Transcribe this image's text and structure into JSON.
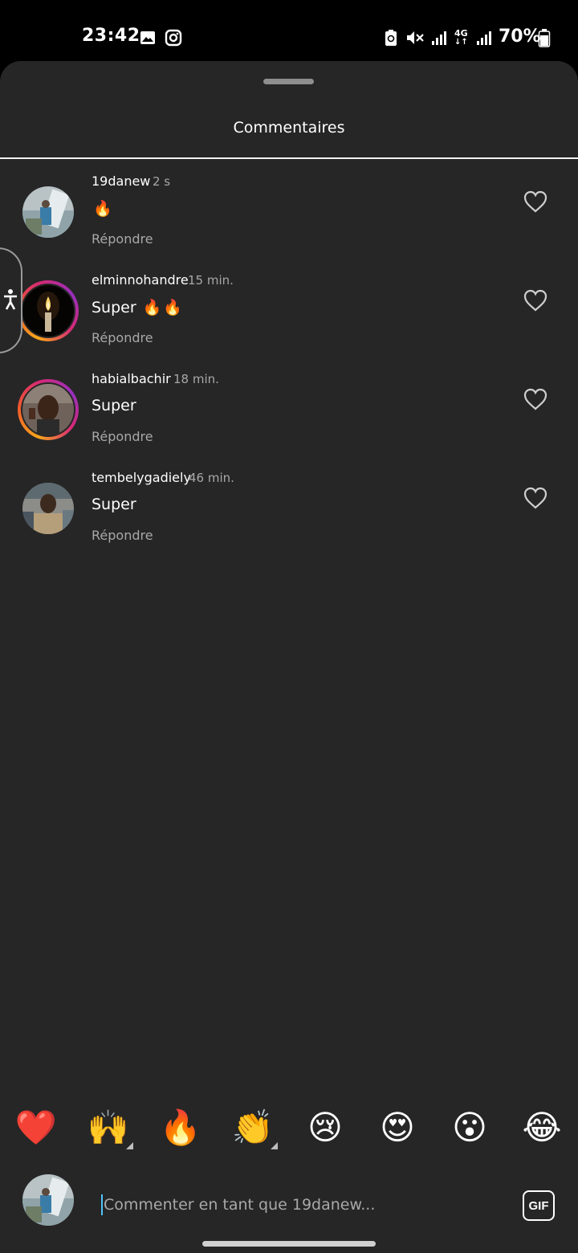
{
  "status_bar": {
    "time": "23:42",
    "battery": "70%",
    "network": "4G"
  },
  "sheet": {
    "title": "Commentaires"
  },
  "comments": [
    {
      "username": "19danew",
      "time": "2 s",
      "text": "",
      "emojis": [
        "🔥"
      ],
      "reply_label": "Répondre"
    },
    {
      "username": "elminnohandre",
      "time": "15 min.",
      "text": "Super",
      "emojis": [
        "🔥",
        "🔥"
      ],
      "reply_label": "Répondre"
    },
    {
      "username": "habialbachir",
      "time": "18 min.",
      "text": "Super",
      "emojis": [],
      "reply_label": "Répondre"
    },
    {
      "username": "tembelygadiely",
      "time": "46 min.",
      "text": "Super",
      "emojis": [],
      "reply_label": "Répondre"
    }
  ],
  "quick_emojis": [
    "❤️",
    "🙌",
    "🔥",
    "👏",
    "😢",
    "😍",
    "😮",
    "😂"
  ],
  "composer": {
    "placeholder": "Commenter en tant que 19danew...",
    "gif_label": "GIF"
  },
  "colors": {
    "sheet_bg": "#262626",
    "secondary_text": "#a8a8a8",
    "caret": "#4fc3f7"
  }
}
